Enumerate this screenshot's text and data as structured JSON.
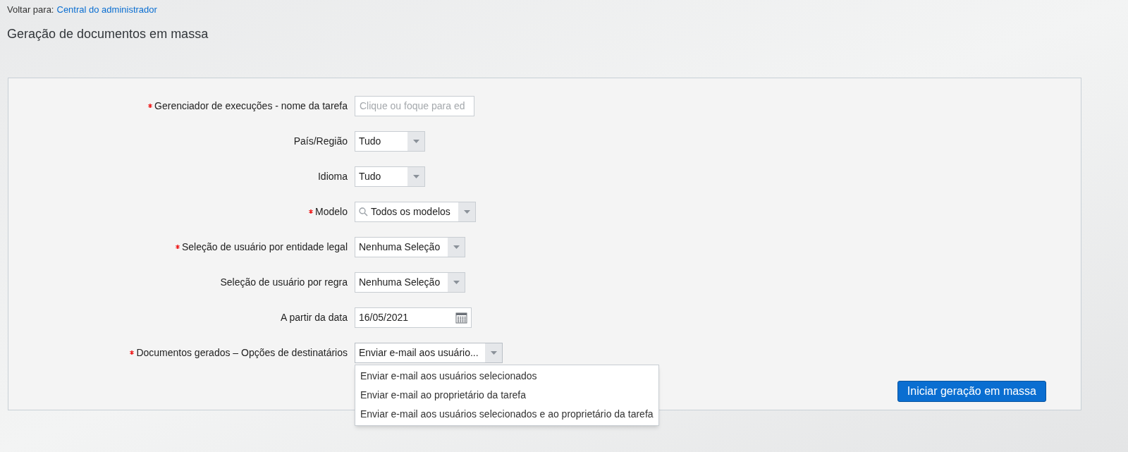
{
  "breadcrumb": {
    "prefix": "Voltar para:",
    "link": "Central do administrador"
  },
  "title": "Geração de documentos em massa",
  "form": {
    "fields": [
      {
        "kind": "text",
        "label": "Gerenciador de execuções - nome da tarefa",
        "required": true,
        "placeholder": "Clique ou foque para ed"
      },
      {
        "kind": "select",
        "label": "País/Região",
        "required": false,
        "value": "Tudo"
      },
      {
        "kind": "select",
        "label": "Idioma",
        "required": false,
        "value": "Tudo"
      },
      {
        "kind": "search-select",
        "label": "Modelo",
        "required": true,
        "value": "Todos os modelos"
      },
      {
        "kind": "select",
        "label": "Seleção de usuário por entidade legal",
        "required": true,
        "value": "Nenhuma Seleção"
      },
      {
        "kind": "select",
        "label": "Seleção de usuário por regra",
        "required": false,
        "value": "Nenhuma Seleção"
      },
      {
        "kind": "date",
        "label": "A partir da data",
        "required": false,
        "value": "16/05/2021"
      },
      {
        "kind": "select",
        "label": "Documentos gerados – Opções de destinatários",
        "required": true,
        "value": "Enviar e-mail aos usuário...",
        "expanded": true,
        "options": [
          "Enviar e-mail aos usuários selecionados",
          "Enviar e-mail ao proprietário da tarefa",
          "Enviar e-mail aos usuários selecionados e ao proprietário da tarefa"
        ]
      }
    ],
    "submit": "Iniciar geração em massa"
  }
}
